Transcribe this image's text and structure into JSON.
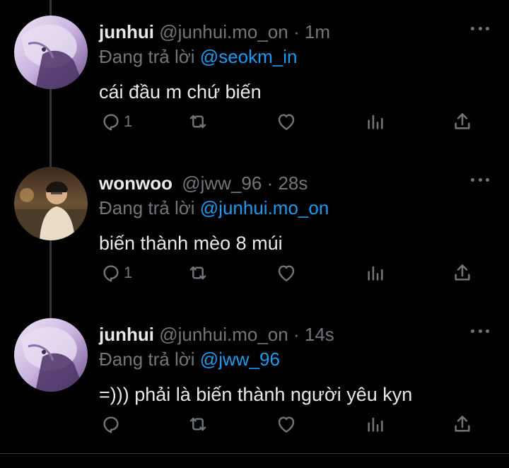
{
  "tweets": [
    {
      "name": "junhui",
      "handle": "@junhui.mo_on",
      "dot": "·",
      "time": "1m",
      "reply_prefix": "Đang trả lời",
      "reply_to": "@seokm_in",
      "text": "cái đầu m chứ biến",
      "reply_count": "1",
      "avatar": "junhui-avatar"
    },
    {
      "name": "wonwoo",
      "handle": "@jww_96",
      "dot": "·",
      "time": "28s",
      "reply_prefix": "Đang trả lời",
      "reply_to": "@junhui.mo_on",
      "text": "biến thành mèo 8 múi",
      "reply_count": "1",
      "avatar": "wonwoo-avatar"
    },
    {
      "name": "junhui",
      "handle": "@junhui.mo_on",
      "dot": "·",
      "time": "14s",
      "reply_prefix": "Đang trả lời",
      "reply_to": "@jww_96",
      "text": "=))) phải là biến thành người yêu kyn",
      "reply_count": "",
      "avatar": "junhui-avatar"
    }
  ],
  "icons": {
    "reply": "reply-icon",
    "retweet": "retweet-icon",
    "like": "like-icon",
    "views": "views-icon",
    "share": "share-icon",
    "more": "more-icon"
  },
  "colors": {
    "background": "#000000",
    "text": "#e7e9ea",
    "muted": "#71767b",
    "link": "#1d9bf0"
  }
}
